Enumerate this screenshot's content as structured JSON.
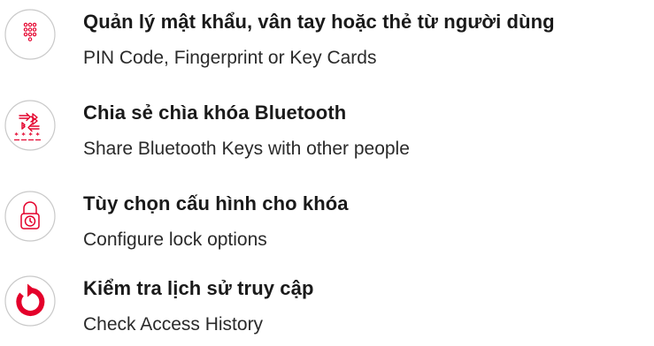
{
  "accent_color": "#e4002b",
  "features": [
    {
      "icon": "keypad-icon",
      "title": "Quản lý mật khẩu, vân tay hoặc thẻ từ người dùng",
      "subtitle": "PIN Code, Fingerprint or Key Cards"
    },
    {
      "icon": "bluetooth-share-icon",
      "title": "Chia sẻ chìa khóa Bluetooth",
      "subtitle": "Share Bluetooth Keys with other people"
    },
    {
      "icon": "padlock-clock-icon",
      "title": "Tùy chọn cấu hình cho khóa",
      "subtitle": "Configure lock options"
    },
    {
      "icon": "history-icon",
      "title": "Kiểm tra lịch sử truy cập",
      "subtitle": "Check Access History"
    }
  ]
}
